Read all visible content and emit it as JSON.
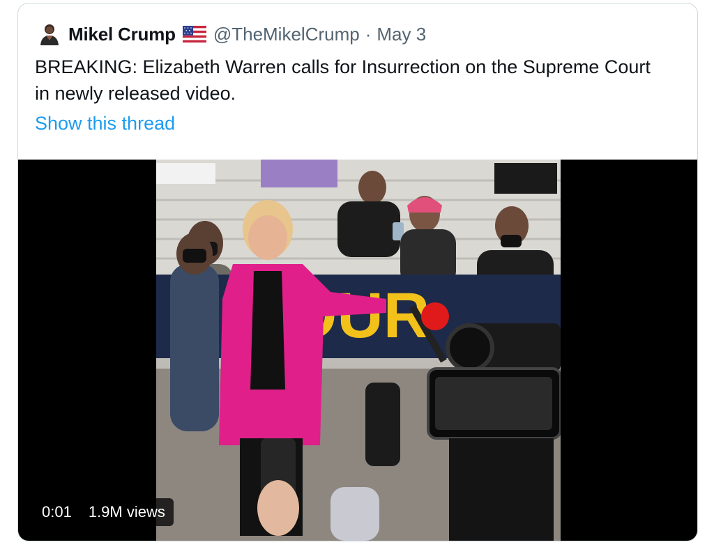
{
  "tweet": {
    "author_name": "Mikel Crump",
    "handle": "@TheMikelCrump",
    "separator": "·",
    "date": "May 3",
    "text": "BREAKING: Elizabeth Warren calls for Insurrection on the Supreme Court in newly released video.",
    "show_thread_label": "Show this thread",
    "flag_icon": "us-flag-icon",
    "colors": {
      "link": "#1d9bf0",
      "secondary": "#536471",
      "border": "#cfd9de"
    }
  },
  "video": {
    "elapsed": "0:01",
    "views": "1.9M views",
    "banner_text": "OUR"
  }
}
